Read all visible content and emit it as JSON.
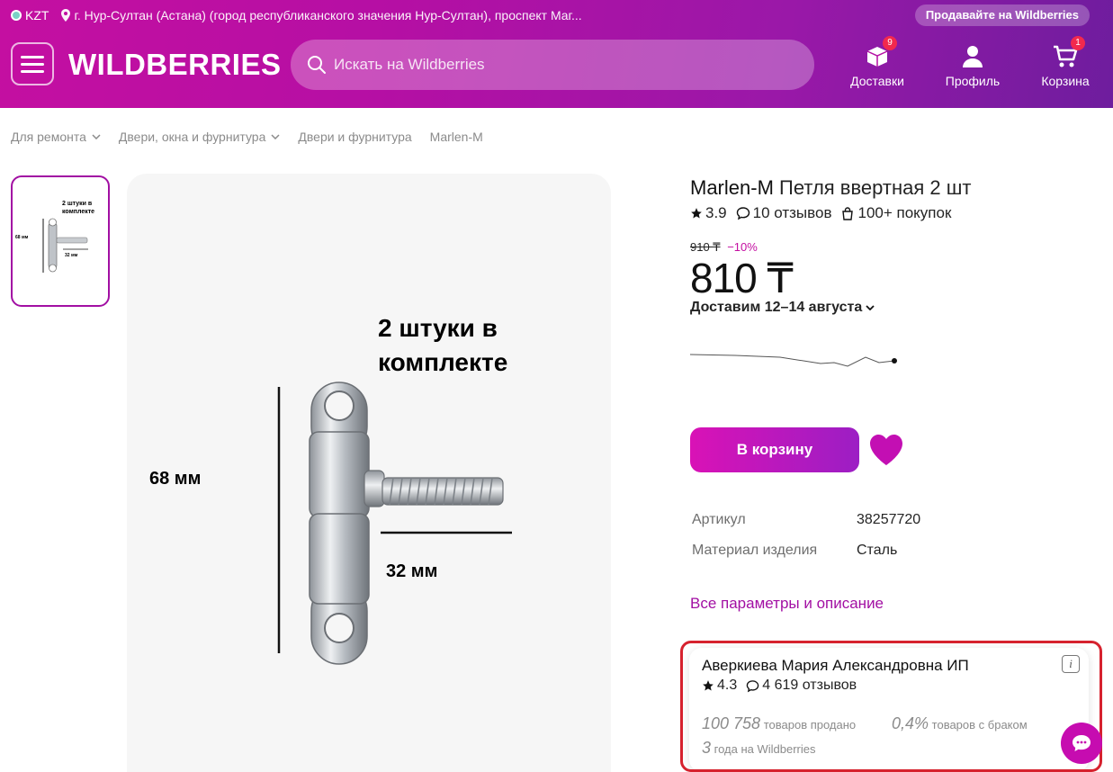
{
  "header": {
    "currency": "KZT",
    "location": "г. Нур-Султан (Астана) (город республиканского значения Нур-Султан), проспект Маг...",
    "sell_label": "Продавайте на Wildberries",
    "logo": "WILDBERRIES",
    "search_placeholder": "Искать на Wildberries",
    "nav": [
      {
        "label": "Доставки",
        "badge": "9",
        "icon": "box-icon"
      },
      {
        "label": "Профиль",
        "badge": "",
        "icon": "user-icon"
      },
      {
        "label": "Корзина",
        "badge": "1",
        "icon": "cart-icon"
      }
    ]
  },
  "breadcrumbs": [
    "Для ремонта",
    "Двери, окна и фурнитура",
    "Двери и фурнитура",
    "Marlen-M"
  ],
  "image": {
    "caption_line1": "2 штуки в",
    "caption_line2": "комплекте",
    "dim_height": "68 мм",
    "dim_width": "32 мм",
    "thumb_line1": "2 штуки в",
    "thumb_line2": "комплекте",
    "thumb_height": "68 мм",
    "thumb_width": "32 мм"
  },
  "product": {
    "brand": "Marlen-M",
    "name": "Петля ввертная 2 шт",
    "rating": "3.9",
    "reviews": "10 отзывов",
    "purchases": "100+ покупок",
    "old_price": "910 ₸",
    "discount": "−10%",
    "price": "810 ₸",
    "delivery": "Доставим 12–14 августа",
    "cart_label": "В корзину",
    "params": [
      {
        "name": "Артикул",
        "value": "38257720"
      },
      {
        "name": "Материал изделия",
        "value": "Сталь"
      }
    ],
    "all_params_label": "Все параметры и описание"
  },
  "seller": {
    "name": "Аверкиева Мария Александровна ИП",
    "info_label": "i",
    "rating": "4.3",
    "reviews": "4 619 отзывов",
    "sold_num": "100 758",
    "sold_label": "товаров продано",
    "defect_num": "0,4%",
    "defect_label": "товаров с браком",
    "years_num": "3",
    "years_label": "года на Wildberries"
  },
  "colors": {
    "brand": "#c40fa1",
    "brand_dark": "#6e1d9e",
    "accent_red": "#d6222e"
  }
}
